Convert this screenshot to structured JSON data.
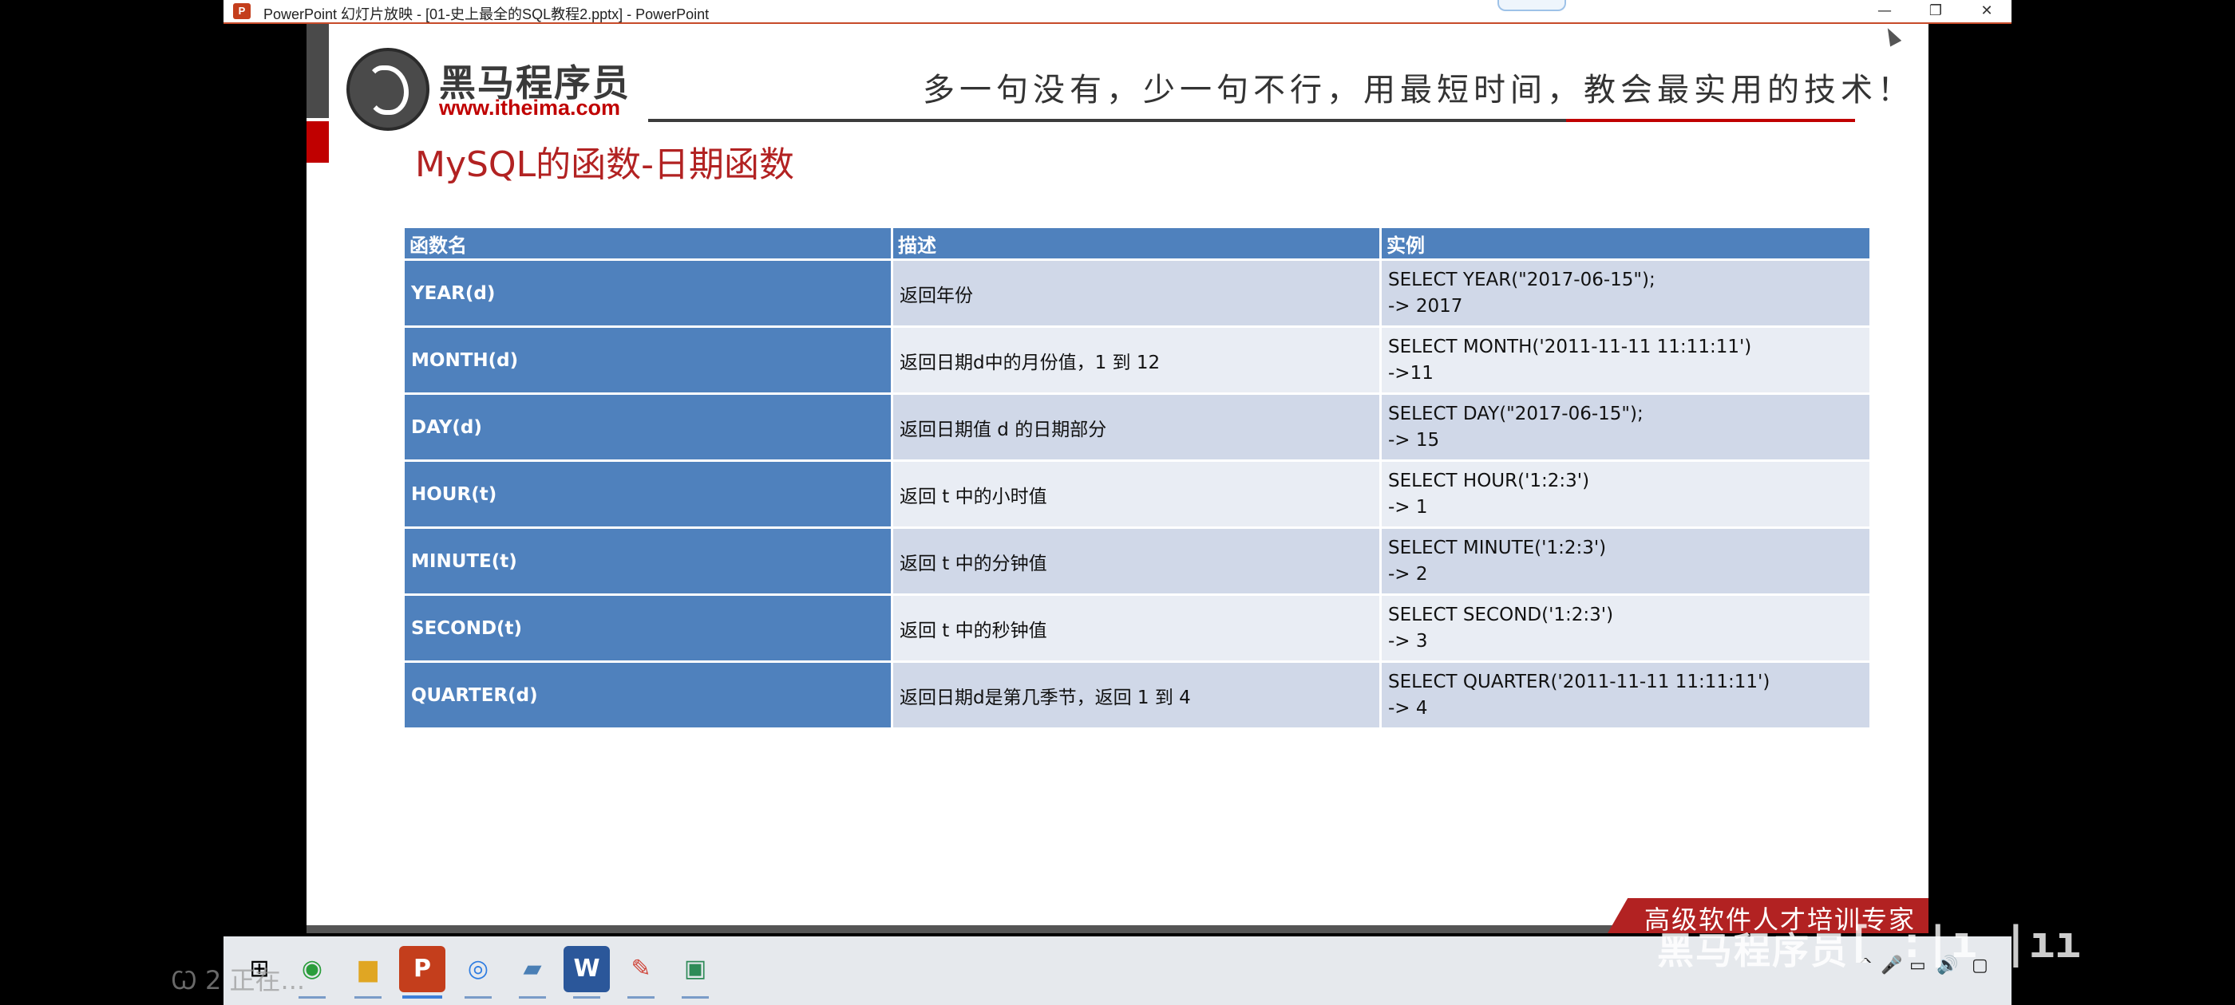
{
  "window": {
    "app_icon_letter": "P",
    "title": "PowerPoint 幻灯片放映 - [01-史上最全的SQL教程2.pptx] - PowerPoint",
    "minimize_glyph": "—",
    "restore_glyph": "❐",
    "close_glyph": "✕"
  },
  "slide": {
    "brand_name": "黑马程序员",
    "brand_url": "www.itheima.com",
    "slogan": "多一句没有，少一句不行，用最短时间，教会最实用的技术！",
    "title": "MySQL的函数-日期函数",
    "table": {
      "headers": [
        "函数名",
        "描述",
        "实例"
      ],
      "rows": [
        {
          "name": "YEAR(d)",
          "desc": "返回年份",
          "example": "SELECT YEAR(\"2017-06-15\");\n-> 2017"
        },
        {
          "name": "MONTH(d)",
          "desc": "返回日期d中的月份值，1 到 12",
          "example": "SELECT MONTH('2011-11-11 11:11:11')\n->11"
        },
        {
          "name": "DAY(d)",
          "desc": "返回日期值 d 的日期部分",
          "example": "SELECT DAY(\"2017-06-15\");\n-> 15"
        },
        {
          "name": "HOUR(t)",
          "desc": "返回 t 中的小时值",
          "example": "SELECT HOUR('1:2:3')\n-> 1"
        },
        {
          "name": "MINUTE(t)",
          "desc": "返回 t 中的分钟值",
          "example": "SELECT MINUTE('1:2:3')\n-> 2"
        },
        {
          "name": "SECOND(t)",
          "desc": "返回 t 中的秒钟值",
          "example": "SELECT SECOND('1:2:3')\n-> 3"
        },
        {
          "name": "QUARTER(d)",
          "desc": "返回日期d是第几季节，返回 1 到 4",
          "example": "SELECT QUARTER('2011-11-11 11:11:11')\n-> 4"
        }
      ]
    },
    "footer_badge": "高级软件人才培训专家"
  },
  "overlay": {
    "brand_watermark": "黑马程序员",
    "marks": "[ :|ı |ıı",
    "left_watermark": "Ꞷ 2 正在..."
  },
  "taskbar": {
    "items": [
      {
        "icon": "windows-start-icon",
        "glyph": "⊞"
      },
      {
        "icon": "chrome-icon",
        "glyph": "◉"
      },
      {
        "icon": "file-explorer-icon",
        "glyph": "▆"
      },
      {
        "icon": "powerpoint-icon",
        "glyph": "P"
      },
      {
        "icon": "browser-icon",
        "glyph": "◎"
      },
      {
        "icon": "app-icon",
        "glyph": "▰"
      },
      {
        "icon": "word-icon",
        "glyph": "W"
      },
      {
        "icon": "editor-icon",
        "glyph": "✎"
      },
      {
        "icon": "sheet-icon",
        "glyph": "▣"
      }
    ],
    "tray": {
      "chevron": "^",
      "mic": "🎤",
      "network": "▭",
      "volume": "🔊",
      "notification": "▢"
    }
  },
  "colors": {
    "header_blue": "#4f81bd",
    "row_light": "#e9edf4",
    "row_dark": "#d0d8e8",
    "brand_red": "#c00000",
    "title_red": "#b22222"
  }
}
